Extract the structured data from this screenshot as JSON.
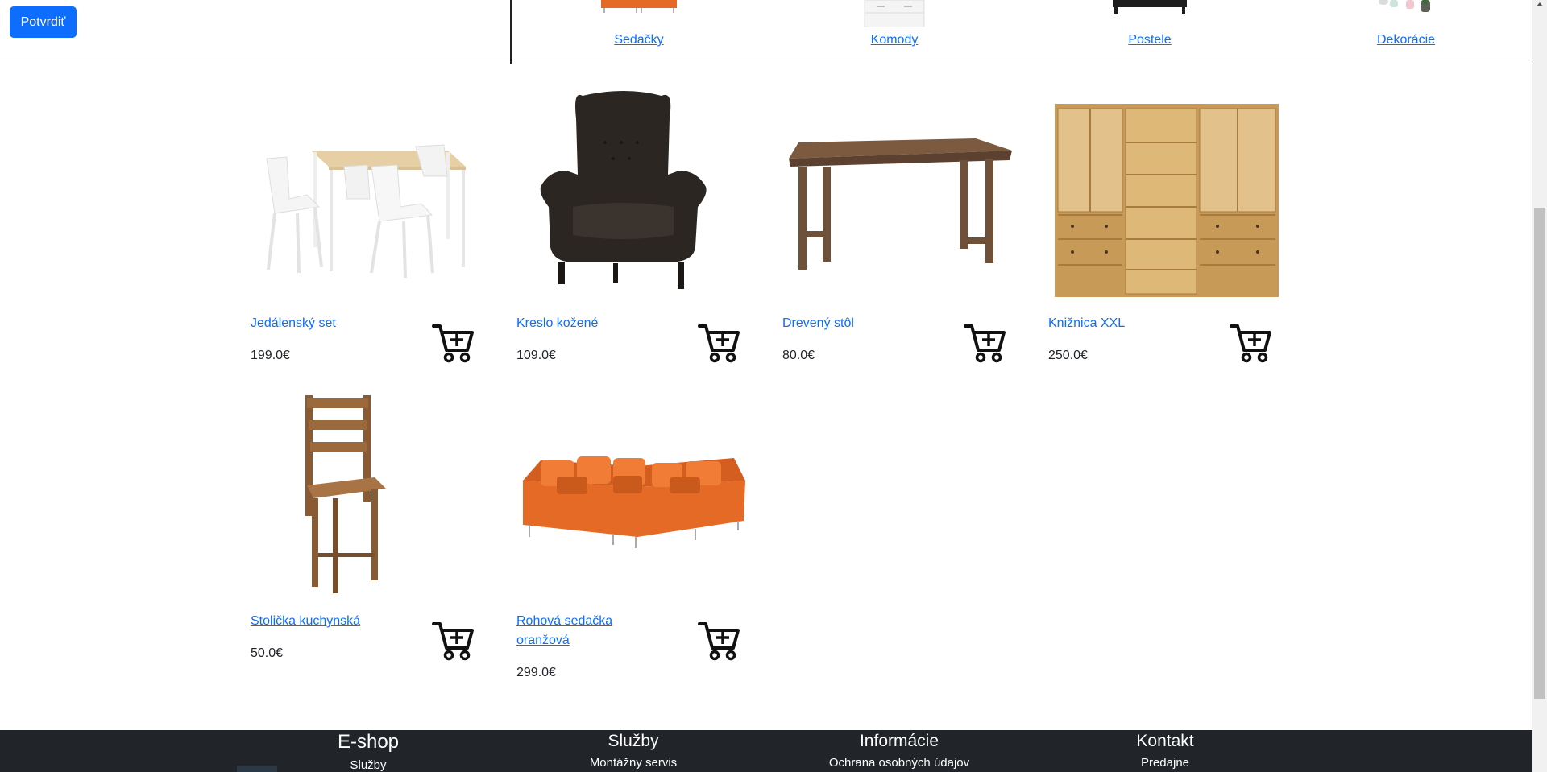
{
  "top_bar": {
    "confirm_label": "Potvrdiť",
    "categories": [
      {
        "label": "Sedačky",
        "icon": "sofa-thumbnail"
      },
      {
        "label": "Komody",
        "icon": "dresser-thumbnail"
      },
      {
        "label": "Postele",
        "icon": "bed-thumbnail"
      },
      {
        "label": "Dekorácie",
        "icon": "decor-thumbnail"
      }
    ]
  },
  "products": [
    {
      "name": "Jedálenský set",
      "price": "199.0€",
      "icon": "dining-set-image"
    },
    {
      "name": "Kreslo kožené",
      "price": "109.0€",
      "icon": "armchair-image"
    },
    {
      "name": "Drevený stôl",
      "price": "80.0€",
      "icon": "wooden-table-image"
    },
    {
      "name": "Knižnica XXL",
      "price": "250.0€",
      "icon": "bookcase-image"
    },
    {
      "name": "Stolička kuchynská",
      "price": "50.0€",
      "icon": "kitchen-chair-image"
    },
    {
      "name": "Rohová sedačka oranžová",
      "price": "299.0€",
      "icon": "corner-sofa-image"
    }
  ],
  "cart_icon": "cart-plus-icon",
  "footer": {
    "brand": "E-shop",
    "brand_link": "Služby",
    "services_title": "Služby",
    "services_link": "Montážny servis",
    "info_title": "Informácie",
    "info_link": "Ochrana osobných údajov",
    "contact_title": "Kontakt",
    "contact_link": "Predajne"
  },
  "colors": {
    "primary": "#0d6efd",
    "footer_bg": "#212529",
    "text": "#212529"
  }
}
